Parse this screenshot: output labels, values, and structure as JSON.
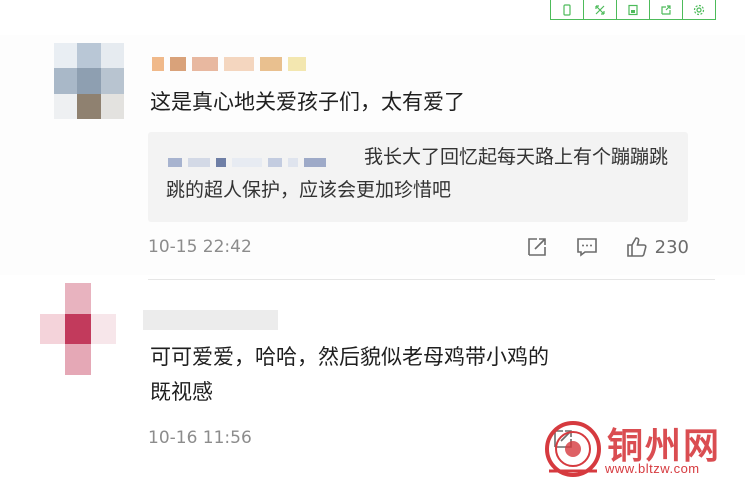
{
  "comment1": {
    "text": "这是真心地关爱孩子们，太有爱了",
    "quote": "我长大了回忆起每天路上有个蹦蹦跳跳的超人保护，应该会更加珍惜吧",
    "time": "10-15 22:42",
    "likes": "230"
  },
  "comment2": {
    "text_line1": "可可爱爱，哈哈，然后貌似老母鸡带小鸡的",
    "text_line2": "既视感",
    "time": "10-16 11:56"
  },
  "watermark": {
    "title": "铜州网",
    "url": "www.bltzw.com"
  },
  "colors": {
    "toolbar_border": "#4dbb5a",
    "watermark_red": "#d63a3f",
    "quote_bg": "#f3f3f3",
    "meta_gray": "#8c8c8c"
  },
  "icons": {
    "toolbar": [
      "phone-icon",
      "expand-icon",
      "save-icon",
      "share-icon",
      "settings-icon"
    ],
    "actions": [
      "share-icon",
      "comment-icon",
      "thumbs-up-icon"
    ]
  }
}
